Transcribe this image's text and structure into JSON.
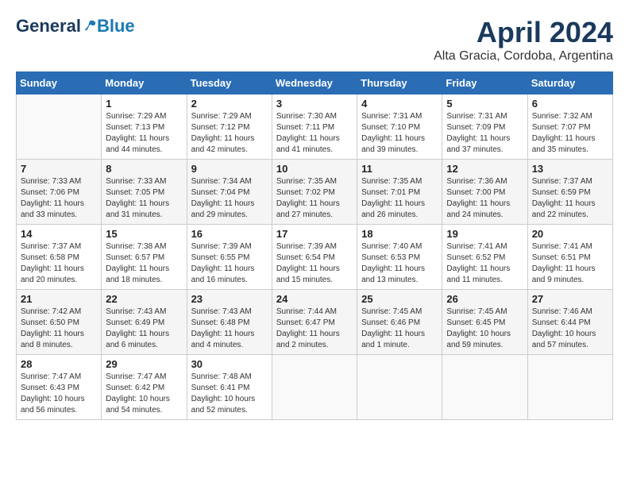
{
  "logo": {
    "general": "General",
    "blue": "Blue"
  },
  "title": {
    "month": "April 2024",
    "location": "Alta Gracia, Cordoba, Argentina"
  },
  "headers": [
    "Sunday",
    "Monday",
    "Tuesday",
    "Wednesday",
    "Thursday",
    "Friday",
    "Saturday"
  ],
  "weeks": [
    [
      {
        "day": "",
        "info": ""
      },
      {
        "day": "1",
        "info": "Sunrise: 7:29 AM\nSunset: 7:13 PM\nDaylight: 11 hours\nand 44 minutes."
      },
      {
        "day": "2",
        "info": "Sunrise: 7:29 AM\nSunset: 7:12 PM\nDaylight: 11 hours\nand 42 minutes."
      },
      {
        "day": "3",
        "info": "Sunrise: 7:30 AM\nSunset: 7:11 PM\nDaylight: 11 hours\nand 41 minutes."
      },
      {
        "day": "4",
        "info": "Sunrise: 7:31 AM\nSunset: 7:10 PM\nDaylight: 11 hours\nand 39 minutes."
      },
      {
        "day": "5",
        "info": "Sunrise: 7:31 AM\nSunset: 7:09 PM\nDaylight: 11 hours\nand 37 minutes."
      },
      {
        "day": "6",
        "info": "Sunrise: 7:32 AM\nSunset: 7:07 PM\nDaylight: 11 hours\nand 35 minutes."
      }
    ],
    [
      {
        "day": "7",
        "info": "Sunrise: 7:33 AM\nSunset: 7:06 PM\nDaylight: 11 hours\nand 33 minutes."
      },
      {
        "day": "8",
        "info": "Sunrise: 7:33 AM\nSunset: 7:05 PM\nDaylight: 11 hours\nand 31 minutes."
      },
      {
        "day": "9",
        "info": "Sunrise: 7:34 AM\nSunset: 7:04 PM\nDaylight: 11 hours\nand 29 minutes."
      },
      {
        "day": "10",
        "info": "Sunrise: 7:35 AM\nSunset: 7:02 PM\nDaylight: 11 hours\nand 27 minutes."
      },
      {
        "day": "11",
        "info": "Sunrise: 7:35 AM\nSunset: 7:01 PM\nDaylight: 11 hours\nand 26 minutes."
      },
      {
        "day": "12",
        "info": "Sunrise: 7:36 AM\nSunset: 7:00 PM\nDaylight: 11 hours\nand 24 minutes."
      },
      {
        "day": "13",
        "info": "Sunrise: 7:37 AM\nSunset: 6:59 PM\nDaylight: 11 hours\nand 22 minutes."
      }
    ],
    [
      {
        "day": "14",
        "info": "Sunrise: 7:37 AM\nSunset: 6:58 PM\nDaylight: 11 hours\nand 20 minutes."
      },
      {
        "day": "15",
        "info": "Sunrise: 7:38 AM\nSunset: 6:57 PM\nDaylight: 11 hours\nand 18 minutes."
      },
      {
        "day": "16",
        "info": "Sunrise: 7:39 AM\nSunset: 6:55 PM\nDaylight: 11 hours\nand 16 minutes."
      },
      {
        "day": "17",
        "info": "Sunrise: 7:39 AM\nSunset: 6:54 PM\nDaylight: 11 hours\nand 15 minutes."
      },
      {
        "day": "18",
        "info": "Sunrise: 7:40 AM\nSunset: 6:53 PM\nDaylight: 11 hours\nand 13 minutes."
      },
      {
        "day": "19",
        "info": "Sunrise: 7:41 AM\nSunset: 6:52 PM\nDaylight: 11 hours\nand 11 minutes."
      },
      {
        "day": "20",
        "info": "Sunrise: 7:41 AM\nSunset: 6:51 PM\nDaylight: 11 hours\nand 9 minutes."
      }
    ],
    [
      {
        "day": "21",
        "info": "Sunrise: 7:42 AM\nSunset: 6:50 PM\nDaylight: 11 hours\nand 8 minutes."
      },
      {
        "day": "22",
        "info": "Sunrise: 7:43 AM\nSunset: 6:49 PM\nDaylight: 11 hours\nand 6 minutes."
      },
      {
        "day": "23",
        "info": "Sunrise: 7:43 AM\nSunset: 6:48 PM\nDaylight: 11 hours\nand 4 minutes."
      },
      {
        "day": "24",
        "info": "Sunrise: 7:44 AM\nSunset: 6:47 PM\nDaylight: 11 hours\nand 2 minutes."
      },
      {
        "day": "25",
        "info": "Sunrise: 7:45 AM\nSunset: 6:46 PM\nDaylight: 11 hours\nand 1 minute."
      },
      {
        "day": "26",
        "info": "Sunrise: 7:45 AM\nSunset: 6:45 PM\nDaylight: 10 hours\nand 59 minutes."
      },
      {
        "day": "27",
        "info": "Sunrise: 7:46 AM\nSunset: 6:44 PM\nDaylight: 10 hours\nand 57 minutes."
      }
    ],
    [
      {
        "day": "28",
        "info": "Sunrise: 7:47 AM\nSunset: 6:43 PM\nDaylight: 10 hours\nand 56 minutes."
      },
      {
        "day": "29",
        "info": "Sunrise: 7:47 AM\nSunset: 6:42 PM\nDaylight: 10 hours\nand 54 minutes."
      },
      {
        "day": "30",
        "info": "Sunrise: 7:48 AM\nSunset: 6:41 PM\nDaylight: 10 hours\nand 52 minutes."
      },
      {
        "day": "",
        "info": ""
      },
      {
        "day": "",
        "info": ""
      },
      {
        "day": "",
        "info": ""
      },
      {
        "day": "",
        "info": ""
      }
    ]
  ]
}
